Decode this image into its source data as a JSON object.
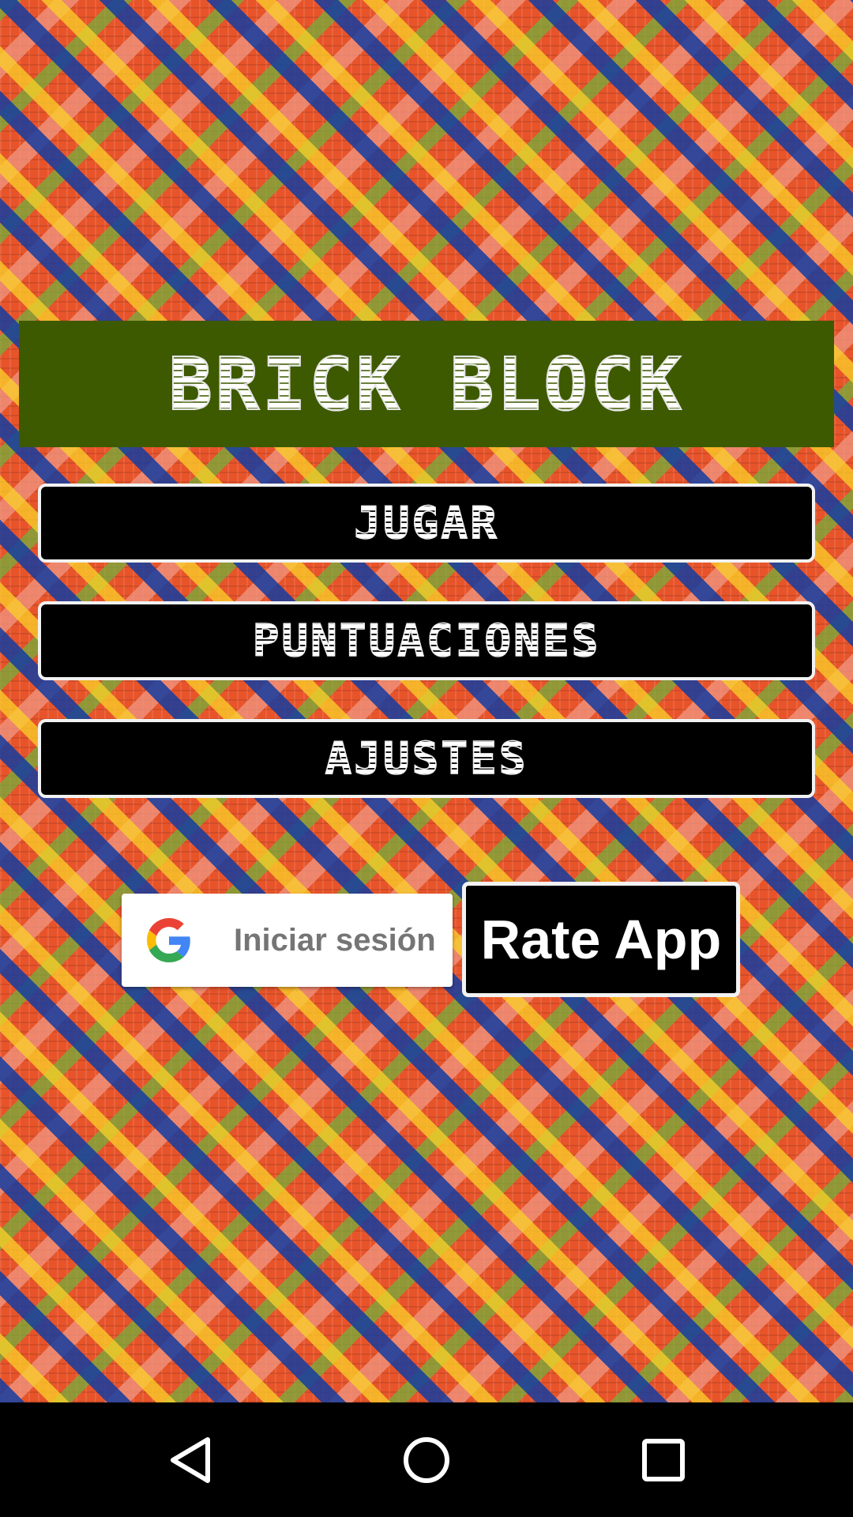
{
  "title": "BRICK BLOCK",
  "menu": {
    "play_label": "JUGAR",
    "scores_label": "PUNTUACIONES",
    "settings_label": "AJUSTES"
  },
  "google_signin": {
    "label": "Iniciar sesión",
    "icon": "google-g-icon"
  },
  "rate_app": {
    "label": "Rate App"
  },
  "navbar": {
    "icons": [
      "back-triangle-icon",
      "home-circle-icon",
      "recents-square-icon"
    ]
  },
  "colors": {
    "title_banner": "#3d5a00",
    "button_bg": "#000000",
    "button_border": "#f2f2f2",
    "google_text": "#757575"
  }
}
